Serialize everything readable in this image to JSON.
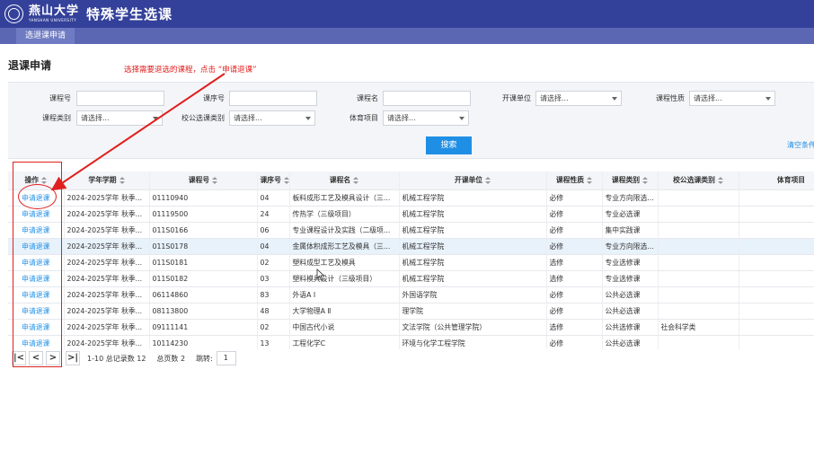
{
  "header": {
    "logo_text": "燕山大学",
    "logo_sub": "YANSHAN UNIVERSITY",
    "app_title": "特殊学生选课"
  },
  "subnav": {
    "active_tab": "选退课申请"
  },
  "page": {
    "title": "退课申请",
    "annotation": "选择需要退选的课程，点击 “申请退课”"
  },
  "filters": {
    "course_code_label": "课程号",
    "course_seq_label": "课序号",
    "course_name_label": "课程名",
    "dept_label": "开课单位",
    "dept_value": "请选择...",
    "nature_label": "课程性质",
    "nature_value": "请选择...",
    "category_label": "课程类别",
    "category_value": "请选择...",
    "elective_label": "校公选课类别",
    "elective_value": "请选择...",
    "sport_label": "体育项目",
    "sport_value": "请选择...",
    "search_button": "搜索",
    "clear_link": "清空条件"
  },
  "table": {
    "columns": [
      "操作",
      "学年学期",
      "课程号",
      "课序号",
      "课程名",
      "开课单位",
      "课程性质",
      "课程类别",
      "校公选课类别",
      "体育项目"
    ],
    "action_label": "申请退课",
    "rows": [
      [
        "2024-2025学年 秋季...",
        "01110940",
        "04",
        "板料成形工艺及模具设计（三...",
        "机械工程学院",
        "必修",
        "专业方向限选...",
        "",
        ""
      ],
      [
        "2024-2025学年 秋季...",
        "01119500",
        "24",
        "传热学（三级项目）",
        "机械工程学院",
        "必修",
        "专业必选课",
        "",
        ""
      ],
      [
        "2024-2025学年 秋季...",
        "011S0166",
        "06",
        "专业课程设计及实践（二级项...",
        "机械工程学院",
        "必修",
        "集中实践课",
        "",
        ""
      ],
      [
        "2024-2025学年 秋季...",
        "011S0178",
        "04",
        "金属体积成形工艺及模具（三...",
        "机械工程学院",
        "必修",
        "专业方向限选...",
        "",
        ""
      ],
      [
        "2024-2025学年 秋季...",
        "011S0181",
        "02",
        "塑料成型工艺及模具",
        "机械工程学院",
        "选修",
        "专业选修课",
        "",
        ""
      ],
      [
        "2024-2025学年 秋季...",
        "011S0182",
        "03",
        "塑料模具设计（三级项目）",
        "机械工程学院",
        "选修",
        "专业选修课",
        "",
        ""
      ],
      [
        "2024-2025学年 秋季...",
        "06114860",
        "83",
        "外语A Ⅰ",
        "外国语学院",
        "必修",
        "公共必选课",
        "",
        ""
      ],
      [
        "2024-2025学年 秋季...",
        "08113800",
        "48",
        "大学物理A Ⅱ",
        "理学院",
        "必修",
        "公共必选课",
        "",
        ""
      ],
      [
        "2024-2025学年 秋季...",
        "09111141",
        "02",
        "中国古代小说",
        "文法学院（公共管理学院）",
        "选修",
        "公共选修课",
        "社会科学类",
        ""
      ],
      [
        "2024-2025学年 秋季...",
        "10114230",
        "13",
        "工程化学C",
        "环境与化学工程学院",
        "必修",
        "公共必选课",
        "",
        ""
      ]
    ]
  },
  "pager": {
    "first": "|<",
    "prev": "<",
    "next": ">",
    "last": ">|",
    "range_text": "1-10 总记录数 12",
    "pages_text": "总页数 2",
    "jump_label": "跳转:",
    "jump_value": "1"
  },
  "colors": {
    "header_bg": "#34419a",
    "subbar_bg": "#5b67b3",
    "link": "#1f8fe6",
    "annotation": "#e0201e"
  }
}
